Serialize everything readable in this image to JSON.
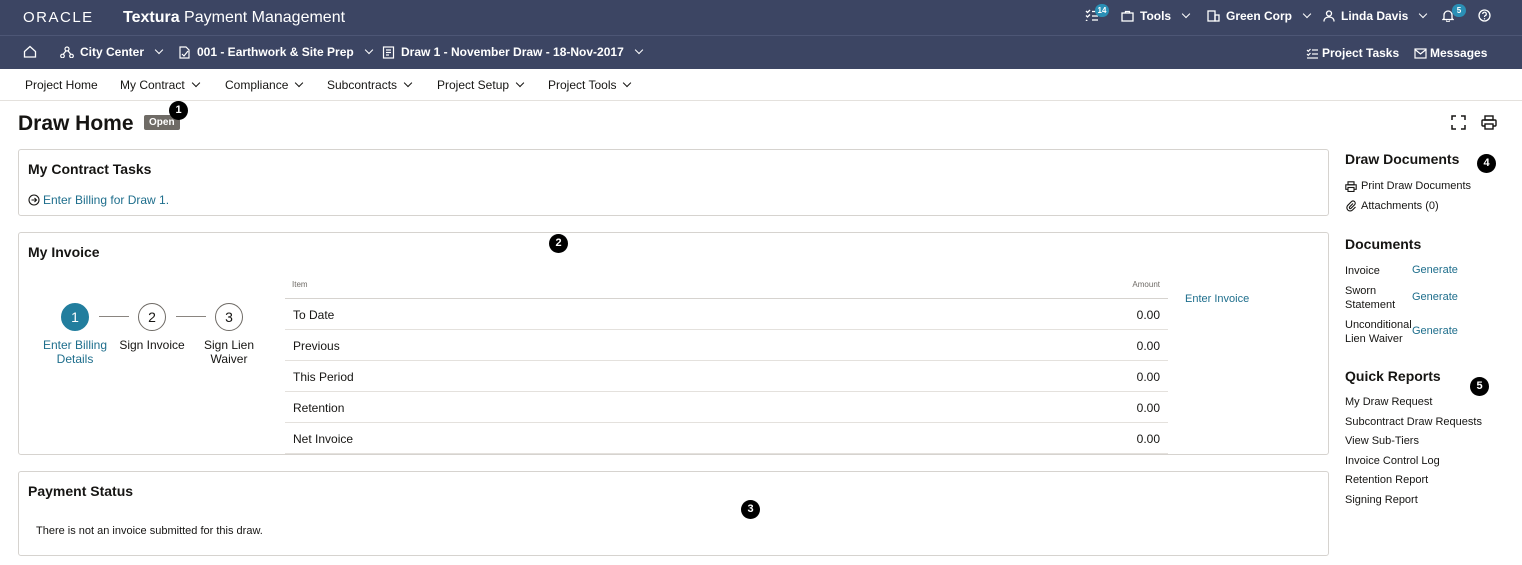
{
  "header": {
    "logo": "ORACLE",
    "product_bold": "Textura",
    "product_rest": " Payment Management",
    "tasks_badge": "14",
    "tools_label": "Tools",
    "org_label": "Green Corp",
    "user_label": "Linda Davis",
    "notifications_badge": "5"
  },
  "subbar": {
    "project": "City Center",
    "contract": "001 - Earthwork & Site Prep",
    "draw": "Draw 1 - November Draw - 18-Nov-2017",
    "project_tasks": "Project Tasks",
    "messages": "Messages"
  },
  "nav": {
    "items": [
      "Project Home",
      "My Contract",
      "Compliance",
      "Subcontracts",
      "Project Setup",
      "Project Tools"
    ]
  },
  "page": {
    "title": "Draw Home",
    "status": "Open"
  },
  "markers": [
    "1",
    "2",
    "3",
    "4",
    "5"
  ],
  "tasks_card": {
    "title": "My Contract Tasks",
    "task_link": "Enter Billing for Draw 1."
  },
  "invoice_card": {
    "title": "My Invoice",
    "steps": [
      {
        "num": "1",
        "label": "Enter Billing Details"
      },
      {
        "num": "2",
        "label": "Sign Invoice"
      },
      {
        "num": "3",
        "label": "Sign Lien Waiver"
      }
    ],
    "table_head": {
      "item": "Item",
      "amount": "Amount"
    },
    "rows": [
      {
        "item": "To Date",
        "amount": "0.00"
      },
      {
        "item": "Previous",
        "amount": "0.00"
      },
      {
        "item": "This Period",
        "amount": "0.00"
      },
      {
        "item": "Retention",
        "amount": "0.00"
      },
      {
        "item": "Net Invoice",
        "amount": "0.00"
      }
    ],
    "enter_invoice": "Enter Invoice"
  },
  "payment_card": {
    "title": "Payment Status",
    "message": "There is not an invoice submitted for this draw."
  },
  "right_panel": {
    "draw_documents_title": "Draw Documents",
    "print_docs": "Print Draw Documents",
    "attachments": "Attachments (0)",
    "documents_title": "Documents",
    "documents": [
      {
        "label": "Invoice",
        "action": "Generate"
      },
      {
        "label": "Sworn Statement",
        "action": "Generate"
      },
      {
        "label": "Unconditional Lien Waiver",
        "action": "Generate"
      }
    ],
    "quick_reports_title": "Quick Reports",
    "reports": [
      "My Draw Request",
      "Subcontract Draw Requests",
      "View Sub-Tiers",
      "Invoice Control Log",
      "Retention Report",
      "Signing Report"
    ]
  }
}
